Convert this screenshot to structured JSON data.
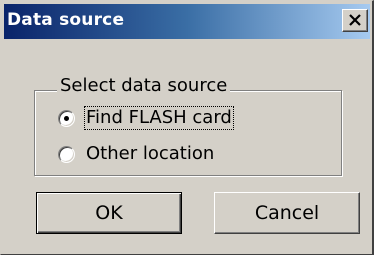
{
  "dialog": {
    "title": "Data source",
    "close_icon": "close-icon"
  },
  "group": {
    "label": "Select data source",
    "options": [
      {
        "label": "Find FLASH card",
        "selected": true
      },
      {
        "label": "Other location",
        "selected": false
      }
    ]
  },
  "buttons": {
    "ok_label": "OK",
    "cancel_label": "Cancel"
  },
  "colors": {
    "face": "#d4d0c8",
    "title_start": "#0a246a",
    "title_end": "#a6caf0"
  }
}
